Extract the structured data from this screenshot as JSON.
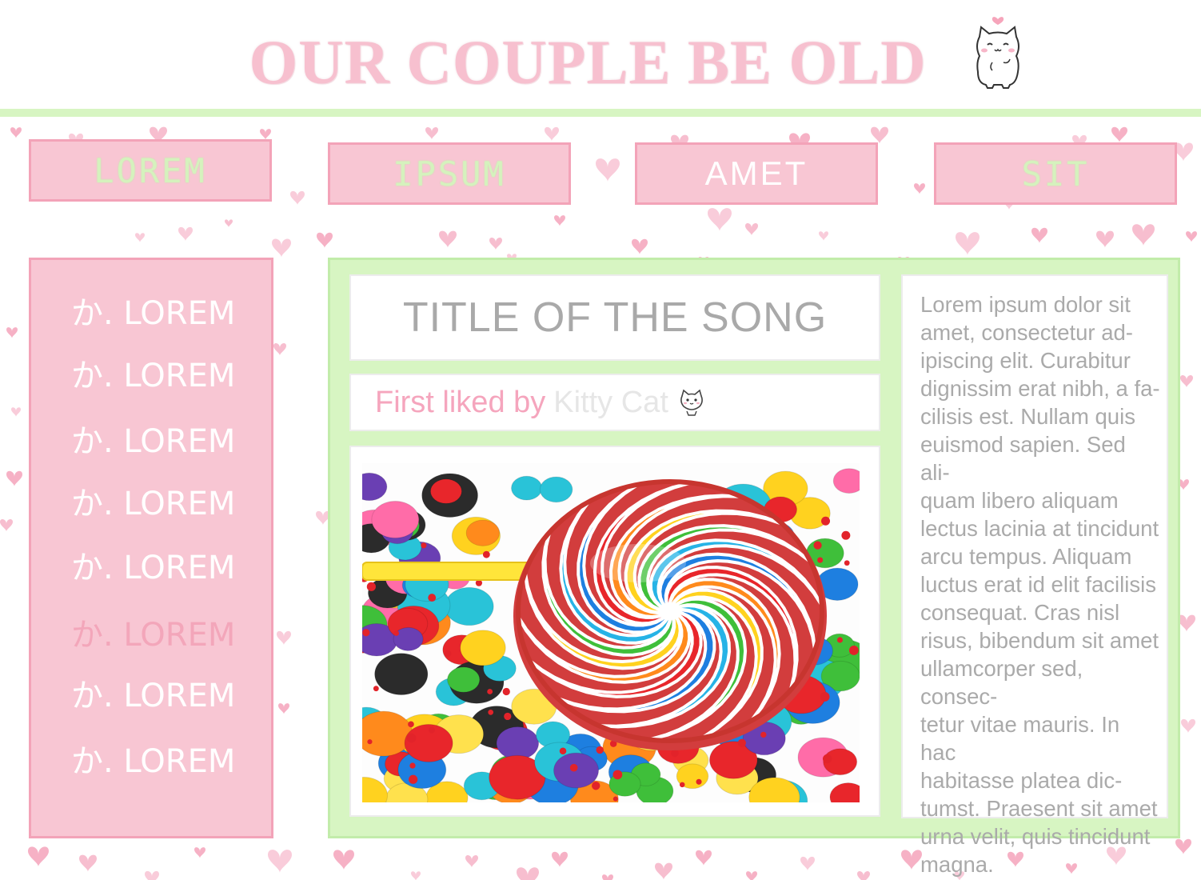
{
  "header": {
    "site_title": "OUR COUPLE BE OLD",
    "mascot_icon": "kitty-cat-icon"
  },
  "nav": [
    {
      "label": "LOREM"
    },
    {
      "label": "IPSUM"
    },
    {
      "label": "AMET"
    },
    {
      "label": "SIT"
    }
  ],
  "sidebar": {
    "items": [
      {
        "label": "か. LOREM"
      },
      {
        "label": "か. LOREM"
      },
      {
        "label": "か. LOREM"
      },
      {
        "label": "か. LOREM"
      },
      {
        "label": "か. LOREM"
      },
      {
        "label": "か. LOREM"
      },
      {
        "label": "か. LOREM"
      },
      {
        "label": "か. LOREM"
      }
    ]
  },
  "main": {
    "song_title": "TITLE OF THE SONG",
    "liked_prefix": "First liked by",
    "liked_name": "Kitty Cat",
    "liked_icon": "kitty-cat-icon",
    "image_subject": "rainbow-lollipop-candy-image",
    "body_text": " Lorem ipsum dolor sit\namet, consectetur ad-\nipiscing elit. Curabitur\ndignissim erat nibh, a fa-\ncilisis est. Nullam quis\neuismod sapien. Sed ali-\nquam libero aliquam\nlectus lacinia at tincidunt\narcu tempus. Aliquam\nluctus erat id elit facilisis\nconsequat. Cras nisl\nrisus, bibendum sit amet\nullamcorper sed, consec-\ntetur vitae mauris. In hac\nhabitasse platea dic-\ntumst. Praesent sit amet\nurna velit, quis tincidunt\nmagna."
  },
  "colors": {
    "pink": "#f8c6d3",
    "pink_border": "#f3a3b8",
    "green": "#d7f5c2",
    "heart": "#f4a3bb"
  },
  "background_icon": "heart-icon"
}
